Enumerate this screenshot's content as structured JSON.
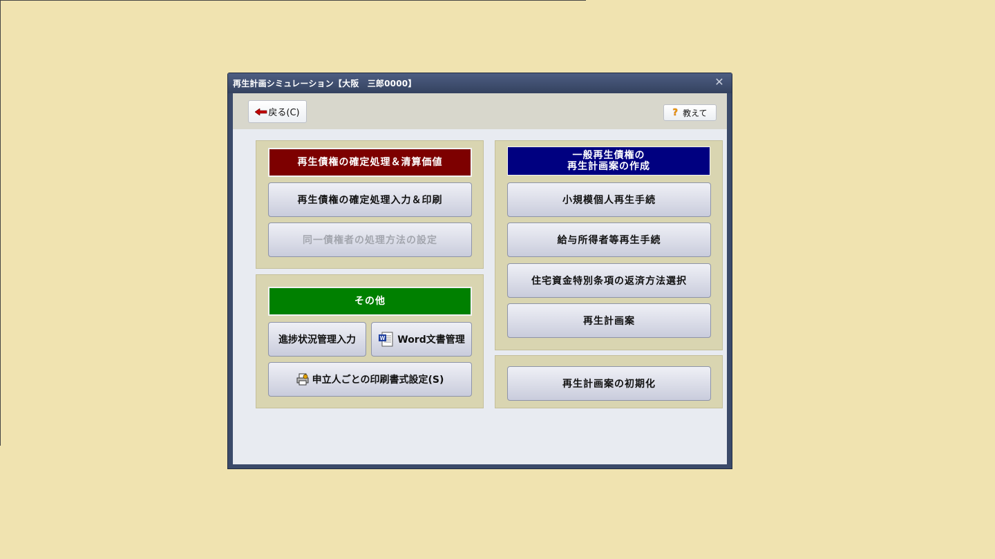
{
  "window": {
    "title": "再生計画シミュレーション【大阪　三郎0000】",
    "close_glyph": "✕"
  },
  "toolbar": {
    "back_label": "戻る(C)",
    "help_label": "教えて"
  },
  "section_confirm": {
    "header": "再生債権の確定処理＆清算価値",
    "buttons": [
      "再生債権の確定処理入力＆印刷",
      "同一債権者の処理方法の設定"
    ]
  },
  "section_other": {
    "header": "その他",
    "progress_label": "進捗状況管理入力",
    "word_label": "Word文書管理",
    "print_format_label": "申立人ごとの印刷書式設定(S)"
  },
  "section_plan": {
    "header_line1": "一般再生債権の",
    "header_line2": "再生計画案の作成",
    "buttons": [
      "小規模個人再生手続",
      "給与所得者等再生手続",
      "住宅資金特別条項の返済方法選択",
      "再生計画案"
    ]
  },
  "section_init": {
    "button": "再生計画案の初期化"
  },
  "icons": {
    "back": "back-arrow-icon",
    "help": "question-icon",
    "word": "word-doc-icon",
    "print_settings": "print-settings-icon"
  },
  "colors": {
    "background": "#f0e3b0",
    "header_red": "#7d0000",
    "header_green": "#008000",
    "header_blue": "#000080"
  }
}
